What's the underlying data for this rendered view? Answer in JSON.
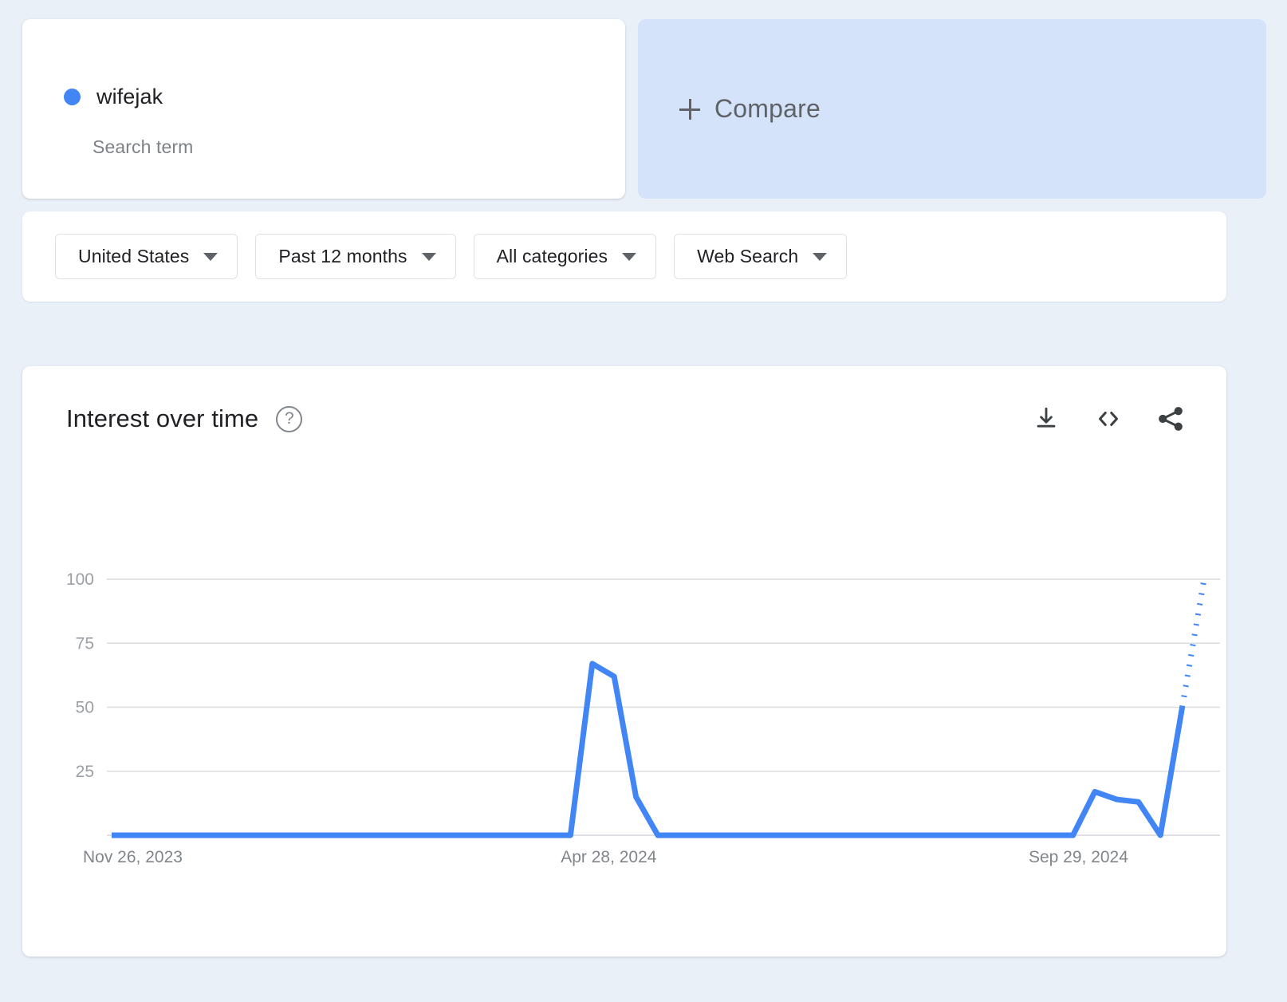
{
  "search_term_card": {
    "term": "wifejak",
    "type_label": "Search term",
    "dot_color": "#4285f4"
  },
  "compare_card": {
    "label": "Compare",
    "plus_icon": "plus-icon",
    "background": "#d4e3f9"
  },
  "filters": [
    {
      "label": "United States",
      "name": "location-filter"
    },
    {
      "label": "Past 12 months",
      "name": "time-range-filter"
    },
    {
      "label": "All categories",
      "name": "category-filter"
    },
    {
      "label": "Web Search",
      "name": "search-type-filter"
    }
  ],
  "chart_panel": {
    "title": "Interest over time",
    "help_icon": "help-circle-icon",
    "help_glyph": "?",
    "actions": [
      {
        "name": "download-csv-button",
        "icon": "download-icon"
      },
      {
        "name": "embed-code-button",
        "icon": "code-embed-icon"
      },
      {
        "name": "share-button",
        "icon": "share-icon"
      }
    ]
  },
  "chart_data": {
    "type": "line",
    "title": "Interest over time",
    "xlabel": "",
    "ylabel": "",
    "ylim": [
      0,
      100
    ],
    "yticks": [
      25,
      50,
      75,
      100
    ],
    "ytick_labels": [
      "25",
      "50",
      "75",
      "100"
    ],
    "xtick_labels": [
      "Nov 26, 2023",
      "Apr 28, 2024",
      "Sep 29, 2024"
    ],
    "xtick_positions": [
      0,
      0.455,
      0.885
    ],
    "grid": true,
    "legend_position": "none",
    "line_color": "#4285f4",
    "series": [
      {
        "name": "wifejak",
        "values": [
          0,
          0,
          0,
          0,
          0,
          0,
          0,
          0,
          0,
          0,
          0,
          0,
          0,
          0,
          0,
          0,
          0,
          0,
          0,
          0,
          0,
          0,
          67,
          62,
          15,
          0,
          0,
          0,
          0,
          0,
          0,
          0,
          0,
          0,
          0,
          0,
          0,
          0,
          0,
          0,
          0,
          0,
          0,
          0,
          0,
          17,
          14,
          13,
          0,
          50,
          100
        ]
      }
    ],
    "partial_data_segment": {
      "style": "dotted",
      "from_value": 50,
      "to_value": 100,
      "note": "final incomplete period shown as dotted line"
    },
    "annotations": []
  }
}
